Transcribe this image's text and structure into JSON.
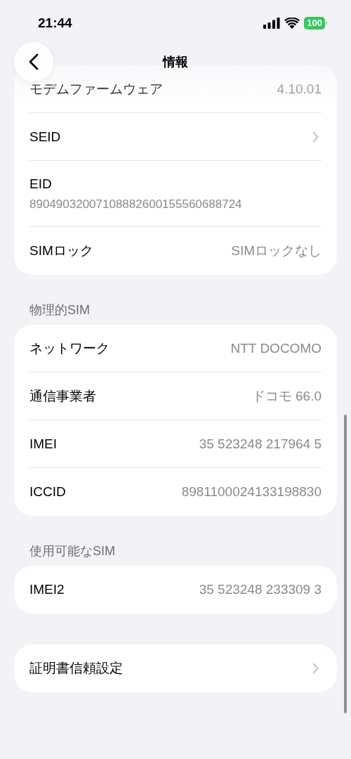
{
  "status_bar": {
    "time": "21:44",
    "battery": "100"
  },
  "nav": {
    "title": "情報"
  },
  "sections": [
    {
      "rows": [
        {
          "kind": "value",
          "label": "モデムファームウェア",
          "value": "4.10.01"
        },
        {
          "kind": "link",
          "label": "SEID"
        },
        {
          "kind": "stacked",
          "label": "EID",
          "value": "89049032007108882600155560688724"
        },
        {
          "kind": "value",
          "label": "SIMロック",
          "value": "SIMロックなし"
        }
      ]
    },
    {
      "header": "物理的SIM",
      "rows": [
        {
          "kind": "value",
          "label": "ネットワーク",
          "value": "NTT DOCOMO"
        },
        {
          "kind": "value",
          "label": "通信事業者",
          "value": "ドコモ 66.0"
        },
        {
          "kind": "value",
          "label": "IMEI",
          "value": "35 523248 217964 5"
        },
        {
          "kind": "value",
          "label": "ICCID",
          "value": "8981100024133198830"
        }
      ]
    },
    {
      "header": "使用可能なSIM",
      "rows": [
        {
          "kind": "value",
          "label": "IMEI2",
          "value": "35 523248 233309 3"
        }
      ]
    },
    {
      "rows": [
        {
          "kind": "link",
          "label": "証明書信頼設定"
        }
      ]
    }
  ]
}
